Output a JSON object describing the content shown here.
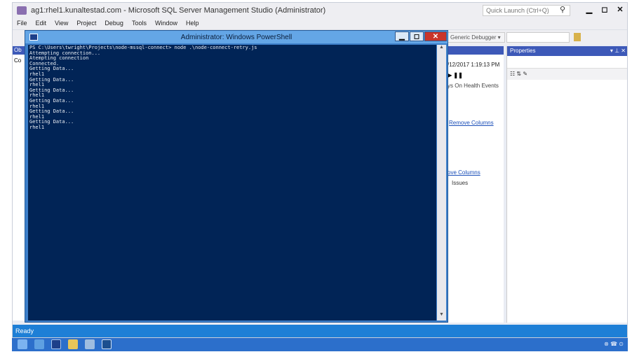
{
  "ssms": {
    "title": "ag1:rhel1.kunaltestad.com - Microsoft SQL Server Management Studio (Administrator)",
    "quick_launch_placeholder": "Quick Launch (Ctrl+Q)",
    "menu": [
      "File",
      "Edit",
      "View",
      "Project",
      "Debug",
      "Tools",
      "Window",
      "Help"
    ],
    "toolbar": {
      "debugger_label": "Generic Debugger"
    },
    "object_explorer": {
      "header": "Ob",
      "row": "Co"
    },
    "document": {
      "timestamp": "/12/2017 1:19:13 PM",
      "pause": "▶ ❚❚",
      "health_events": "ys On Health Events",
      "remove_columns_1": "Remove Columns",
      "remove_columns_2": "ove Columns",
      "issues": "Issues"
    },
    "properties": {
      "title": "Properties",
      "controls": "▾ ⊥ ✕"
    },
    "status": "Ready"
  },
  "powershell": {
    "title": "Administrator: Windows PowerShell",
    "lines": [
      "PS C:\\Users\\twright\\Projects\\node-mssql-connect> node .\\node-connect-retry.js",
      "Attempting connection...",
      "Atempting connection",
      "Connected.",
      "Getting Data...",
      "rhel1",
      "Getting Data...",
      "rhel1",
      "Getting Data...",
      "rhel1",
      "Getting Data...",
      "rhel1",
      "Getting Data...",
      "rhel1",
      "Getting Data...",
      "rhel1"
    ]
  },
  "taskbar": {
    "tray": "⊗ ☎ ⊙"
  }
}
